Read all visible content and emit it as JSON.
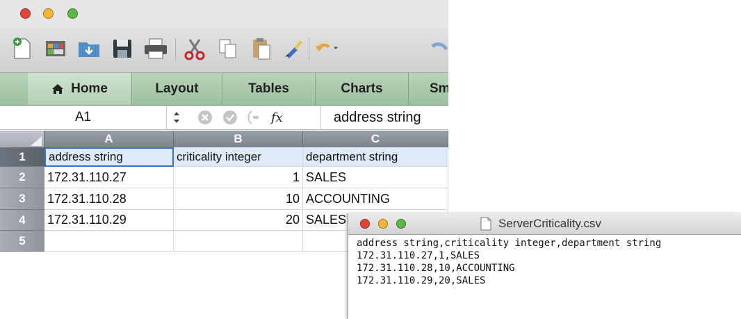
{
  "colors": {
    "ribbon": "#a9c8ab",
    "close": "#e2443a",
    "minimize": "#f2b634",
    "zoom": "#5cb845"
  },
  "toolbar": {
    "icons": [
      "new-workbook-icon",
      "gallery-icon",
      "open-icon",
      "save-icon",
      "print-icon",
      "cut-icon",
      "copy-icon",
      "paste-icon",
      "format-brush-icon",
      "undo-icon",
      "redo-icon"
    ]
  },
  "ribbon": {
    "tabs": [
      "Home",
      "Layout",
      "Tables",
      "Charts",
      "Sm"
    ]
  },
  "formula_bar": {
    "name_box": "A1",
    "fx": "fx",
    "content": "address string"
  },
  "sheet": {
    "columns": [
      "A",
      "B",
      "C"
    ],
    "rows": [
      "1",
      "2",
      "3",
      "4",
      "5"
    ],
    "cells": [
      [
        "address string",
        "criticality integer",
        "department string"
      ],
      [
        "172.31.110.27",
        "1",
        "SALES"
      ],
      [
        "172.31.110.28",
        "10",
        "ACCOUNTING"
      ],
      [
        "172.31.110.29",
        "20",
        "SALES"
      ],
      [
        "",
        "",
        ""
      ]
    ]
  },
  "text_window": {
    "title": "ServerCriticality.csv",
    "lines": [
      "address string,criticality integer,department string",
      "172.31.110.27,1,SALES",
      "172.31.110.28,10,ACCOUNTING",
      "172.31.110.29,20,SALES"
    ]
  }
}
